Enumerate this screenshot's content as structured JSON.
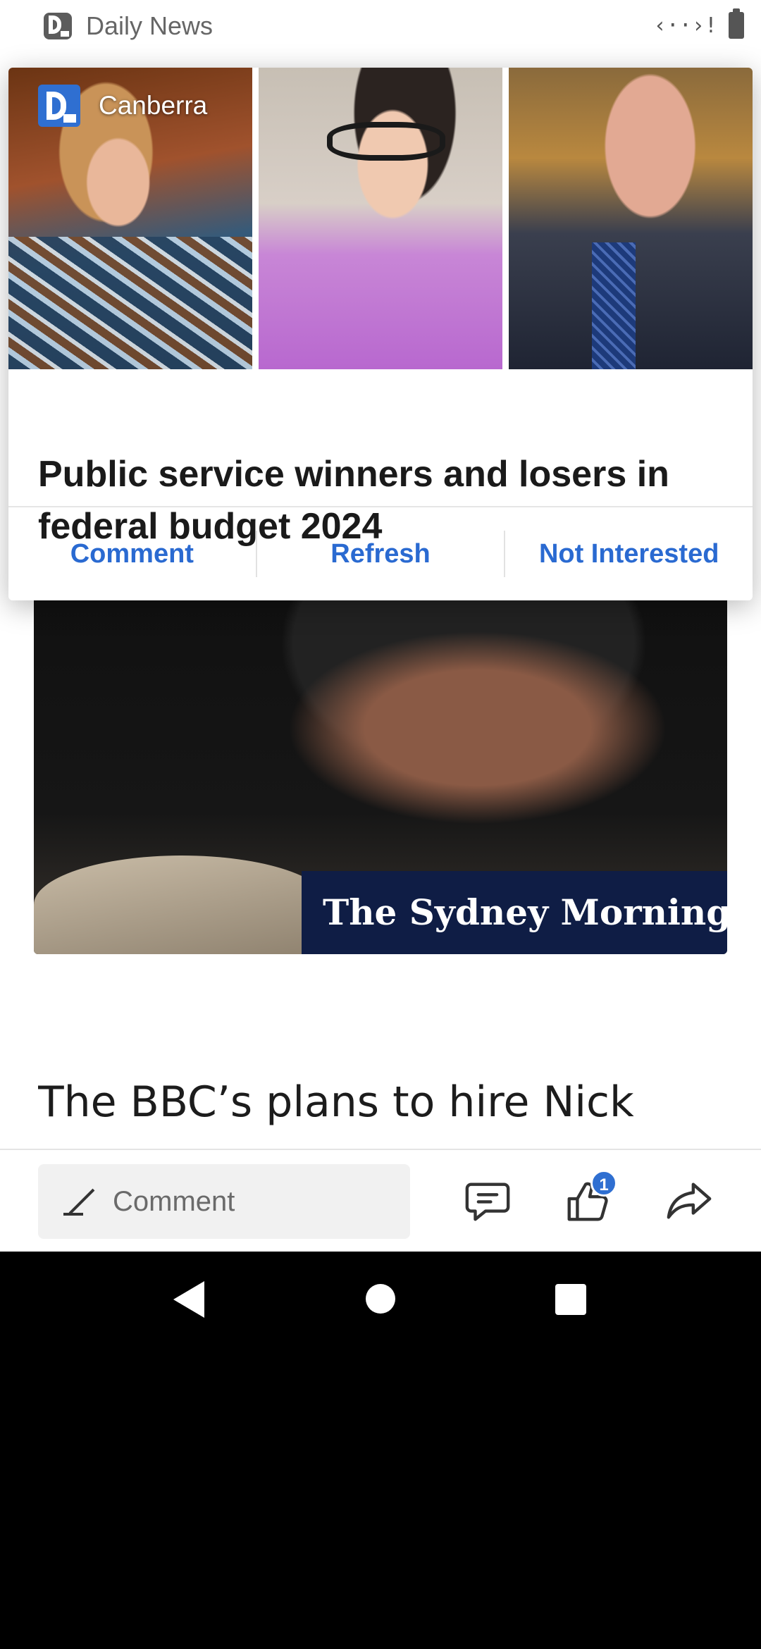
{
  "statusbar": {
    "app_title": "Daily News",
    "status_code": "‹··›!",
    "battery": "battery-icon"
  },
  "notification": {
    "source": "Canberra",
    "headline": "Public service winners and losers in federal budget 2024",
    "actions": {
      "comment": "Comment",
      "refresh": "Refresh",
      "not_interested": "Not Interested"
    },
    "accent_color": "#2a6ad1"
  },
  "article": {
    "hero_banner": "The Sydney Morning Herald",
    "text": "The BBC’s plans to hire Nick"
  },
  "bottombar": {
    "comment_placeholder": "Comment",
    "like_count": "1"
  },
  "navbar": {
    "back": "back-icon",
    "home": "home-icon",
    "recent": "recent-apps-icon"
  }
}
